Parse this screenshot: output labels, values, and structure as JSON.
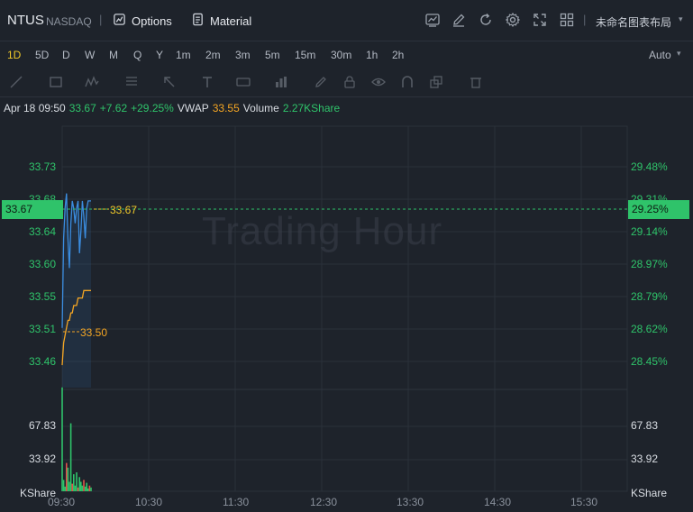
{
  "header": {
    "symbol": "NTUS",
    "exchange": "NASDAQ",
    "separator": "|",
    "options_label": "Options",
    "material_label": "Material",
    "layout_name": "未命名图表布局",
    "layout_caret": "▾"
  },
  "intervals": {
    "items": [
      "1D",
      "5D",
      "D",
      "W",
      "M",
      "Q",
      "Y",
      "1m",
      "2m",
      "3m",
      "5m",
      "15m",
      "30m",
      "1h",
      "2h"
    ],
    "active": "1D",
    "scale_mode": "Auto",
    "scale_caret": "▾"
  },
  "quote": {
    "datetime": "Apr 18 09:50",
    "price": "33.67",
    "change": "+7.62",
    "change_pct": "+29.25%",
    "vwap_label": "VWAP",
    "vwap_value": "33.55",
    "volume_label": "Volume",
    "volume_value": "2.27KShare"
  },
  "chart": {
    "watermark": "Trading Hour",
    "price_axis_left": [
      "33.73",
      "33.68",
      "33.64",
      "33.60",
      "33.55",
      "33.51",
      "33.46"
    ],
    "price_axis_right": [
      "29.48%",
      "29.31%",
      "29.14%",
      "28.97%",
      "28.79%",
      "28.62%",
      "28.45%"
    ],
    "last_price_badge_left": "33.67",
    "last_price_badge_right": "29.25%",
    "last_price_line_label": "33.67",
    "vwap_line_label": "33.50",
    "volume_axis_left": [
      "67.83",
      "33.92",
      "KShare"
    ],
    "volume_axis_right": [
      "67.83",
      "33.92",
      "KShare"
    ],
    "time_axis": [
      "09:30",
      "10:30",
      "11:30",
      "12:30",
      "13:30",
      "14:30",
      "15:30"
    ],
    "colors": {
      "background": "#1e232b",
      "grid": "#2a3039",
      "price_line": "#3b8de0",
      "vwap_line": "#f5a623",
      "up_green": "#2fc36a",
      "last_price_yellow": "#f0c929"
    }
  },
  "chart_data": {
    "type": "line",
    "x": [
      "09:30",
      "09:31",
      "09:32",
      "09:33",
      "09:34",
      "09:35",
      "09:36",
      "09:37",
      "09:38",
      "09:39",
      "09:40",
      "09:41",
      "09:42",
      "09:43",
      "09:44",
      "09:45",
      "09:46",
      "09:47",
      "09:48",
      "09:49",
      "09:50"
    ],
    "series": [
      {
        "name": "",
        "values": [
          33.5,
          33.62,
          33.66,
          33.68,
          33.62,
          33.58,
          33.64,
          33.67,
          33.66,
          33.64,
          33.66,
          33.67,
          33.6,
          33.63,
          33.67,
          33.65,
          33.62,
          33.66,
          33.67,
          33.67,
          33.67
        ]
      },
      {
        "name": "VWAP",
        "values": [
          33.45,
          33.48,
          33.49,
          33.5,
          33.51,
          33.51,
          33.52,
          33.52,
          33.53,
          33.53,
          33.53,
          33.54,
          33.54,
          33.54,
          33.54,
          33.55,
          33.55,
          33.55,
          33.55,
          33.55,
          33.55
        ]
      }
    ],
    "volume": [
      110,
      12,
      5,
      30,
      25,
      10,
      72,
      8,
      18,
      6,
      20,
      4,
      15,
      10,
      6,
      12,
      5,
      9,
      3,
      6,
      4
    ],
    "ylim": [
      33.42,
      33.77
    ],
    "volume_ylim": [
      0,
      105
    ],
    "xlim": [
      "09:30",
      "16:00"
    ],
    "xlabel": "",
    "ylabel": "",
    "grid": true
  }
}
